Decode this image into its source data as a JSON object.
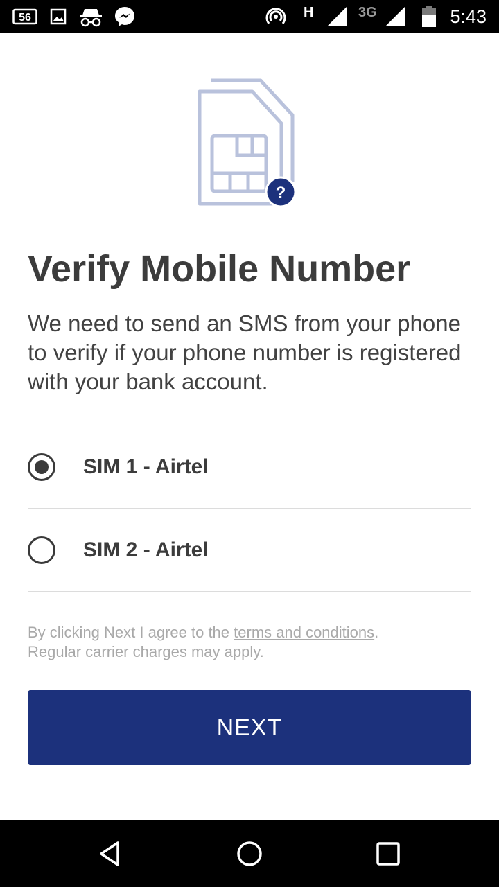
{
  "status_bar": {
    "time": "5:43",
    "notification_badge": "56",
    "network_h": "H",
    "network_3g": "3G",
    "icons": [
      "notification-56-icon",
      "image-icon",
      "incognito-icon",
      "messenger-icon",
      "hotspot-icon",
      "signal-icon",
      "signal-icon",
      "battery-icon"
    ]
  },
  "illustration": {
    "icon": "sim-card-question-icon",
    "badge_text": "?",
    "colors": {
      "sim_stroke": "#b9c2dc",
      "badge": "#1c317c"
    }
  },
  "title": "Verify Mobile Number",
  "description": "We need to send an SMS from your phone to verify if your phone number is registered with your bank account.",
  "sim_options": [
    {
      "label": "SIM 1 - Airtel",
      "selected": true
    },
    {
      "label": "SIM 2 - Airtel",
      "selected": false
    }
  ],
  "terms": {
    "prefix": "By clicking Next I agree to the ",
    "link": "terms and conditions",
    "suffix": ".",
    "line2": "Regular carrier charges may apply."
  },
  "next_button": {
    "label": "NEXT",
    "color": "#1c317c"
  },
  "nav_bar": {
    "icons": [
      "back-icon",
      "home-icon",
      "recents-icon"
    ]
  }
}
